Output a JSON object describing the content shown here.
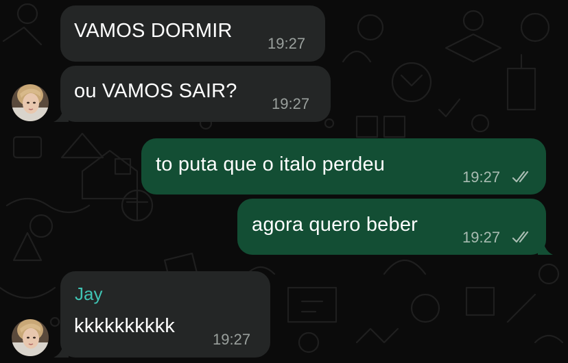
{
  "messages": [
    {
      "text": "VAMOS DORMIR",
      "time": "19:27"
    },
    {
      "text": "ou VAMOS SAIR?",
      "time": "19:27"
    },
    {
      "text": "to puta que o italo perdeu",
      "time": "19:27"
    },
    {
      "text": "agora quero beber",
      "time": "19:27"
    },
    {
      "sender": "Jay",
      "text": "kkkkkkkkkk",
      "time": "19:27"
    }
  ],
  "colors": {
    "background": "#0b0b0b",
    "incoming_bubble": "#242626",
    "outgoing_bubble": "#134e34",
    "sender_name": "#40c4b4",
    "timestamp": "#9aa09d",
    "read_ticks": "#a9bcb2"
  },
  "icons": [
    "double-check-icon",
    "avatar-photo"
  ]
}
